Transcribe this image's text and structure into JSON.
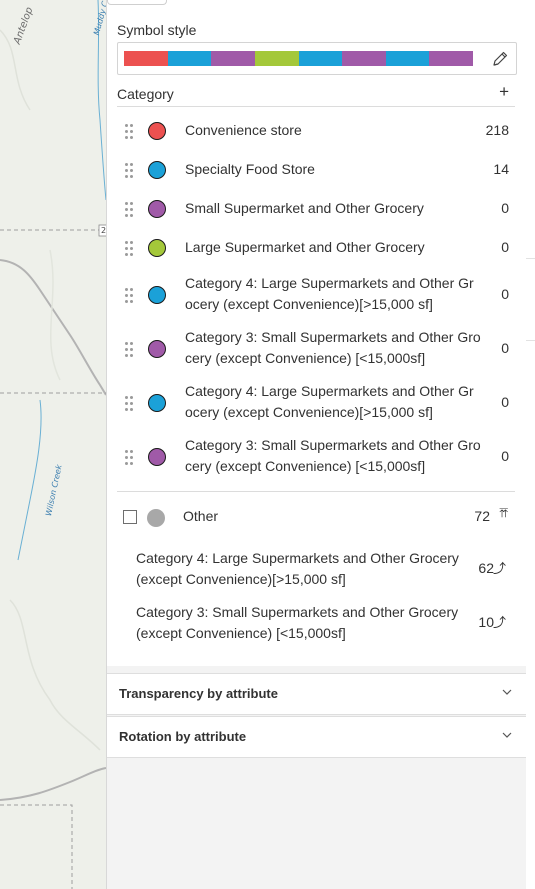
{
  "map": {
    "labels": {
      "antelope": "Antelop",
      "muddy": "Muddy C",
      "wilson": "Wilson Creek",
      "road": "2"
    }
  },
  "symbol_style": {
    "label": "Symbol style",
    "ramp_colors": [
      "#ec5150",
      "#1ba1d8",
      "#a05aa8",
      "#a4c83a",
      "#1ba1d8",
      "#a05aa8",
      "#1ba1d8",
      "#a05aa8"
    ],
    "edit_icon": "pencil-icon"
  },
  "category": {
    "label": "Category",
    "add_icon": "plus-icon",
    "add_glyph": "+",
    "items": [
      {
        "label": "Convenience store",
        "count": "218",
        "color": "#ec5150"
      },
      {
        "label": "Specialty Food Store",
        "count": "14",
        "color": "#1ba1d8"
      },
      {
        "label": "Small Supermarket and Other Grocery",
        "count": "0",
        "color": "#a05aa8"
      },
      {
        "label": "Large Supermarket and Other Grocery",
        "count": "0",
        "color": "#a4c83a"
      },
      {
        "label": "Category 4: Large Supermarkets and Other Grocery (except Convenience)[>15,000 sf]",
        "count": "0",
        "color": "#1ba1d8"
      },
      {
        "label": "Category 3: Small Supermarkets and Other Grocery (except Convenience) [<15,000sf]",
        "count": "0",
        "color": "#a05aa8"
      },
      {
        "label": "Category 4: Large Supermarkets and Other Grocery (except Convenience)[>15,000 sf]",
        "count": "0",
        "color": "#1ba1d8"
      },
      {
        "label": "Category 3: Small Supermarkets and Other Grocery (except Convenience) [<15,000sf]",
        "count": "0",
        "color": "#a05aa8"
      }
    ]
  },
  "other": {
    "label": "Other",
    "count": "72",
    "color": "#a8a8a8",
    "promote_all_icon": "promote-all-icon",
    "promote_all_glyph": "⤒⤒",
    "sub_items": [
      {
        "label": "Category 4: Large Supermarkets and Other Grocery (except Convenience)[>15,000 sf]",
        "count": "62",
        "icon": "promote-icon",
        "glyph": "⤴"
      },
      {
        "label": "Category 3: Small Supermarkets and Other Grocery (except Convenience) [<15,000sf]",
        "count": "10",
        "icon": "promote-icon",
        "glyph": "⤴"
      }
    ]
  },
  "accordions": [
    {
      "title": "Transparency by attribute",
      "icon": "chevron-down-icon"
    },
    {
      "title": "Rotation by attribute",
      "icon": "chevron-down-icon"
    }
  ]
}
